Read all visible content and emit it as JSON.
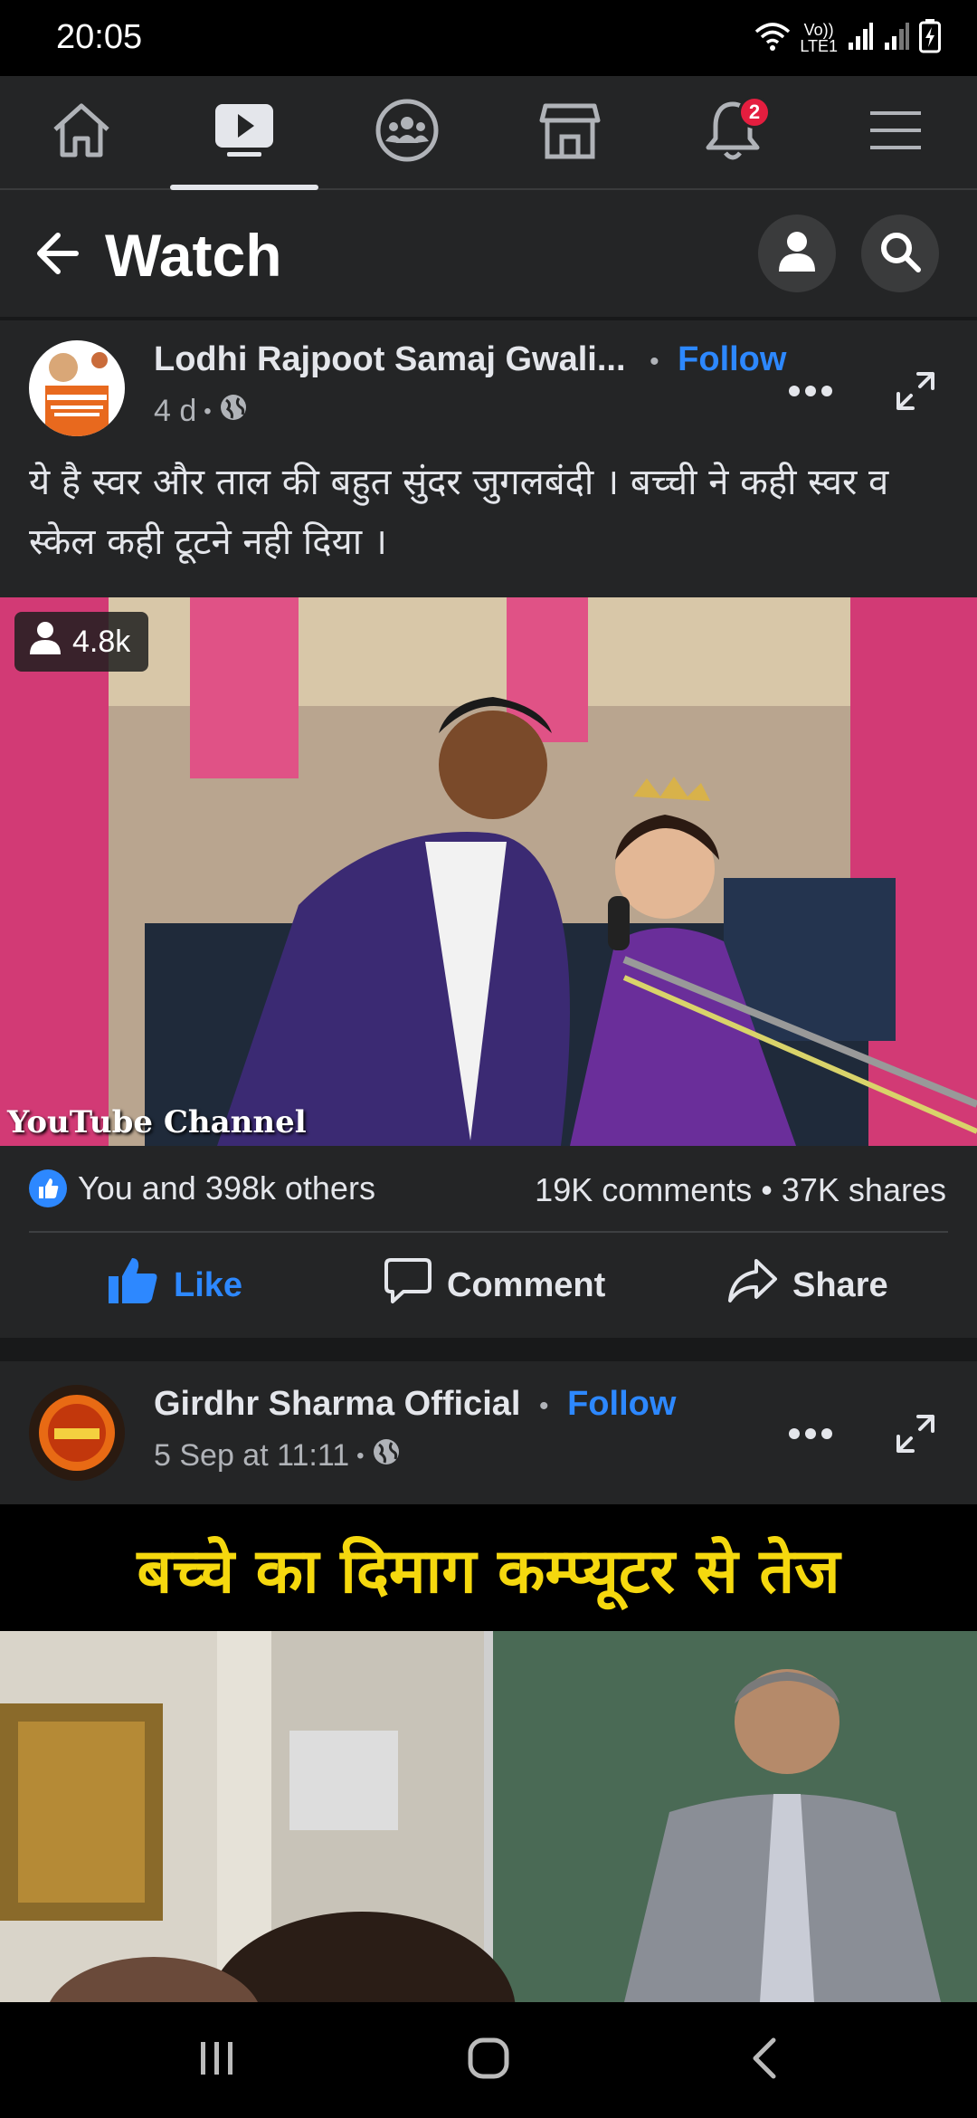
{
  "status_bar": {
    "time": "20:05",
    "network_top": "Vo))",
    "network_bottom": "LTE1",
    "icons": [
      "wifi-icon",
      "signal-icon",
      "signal-icon",
      "battery-charging-icon"
    ]
  },
  "top_nav": {
    "tabs": [
      {
        "name": "home",
        "icon": "home-icon",
        "active": false
      },
      {
        "name": "watch",
        "icon": "video-play-icon",
        "active": true
      },
      {
        "name": "groups",
        "icon": "groups-icon",
        "active": false
      },
      {
        "name": "marketplace",
        "icon": "shop-icon",
        "active": false
      },
      {
        "name": "notifications",
        "icon": "bell-icon",
        "active": false,
        "badge": "2"
      },
      {
        "name": "menu",
        "icon": "hamburger-menu-icon",
        "active": false
      }
    ]
  },
  "watch_header": {
    "title": "Watch",
    "icons": [
      "back-arrow-icon",
      "profile-icon",
      "search-icon"
    ]
  },
  "posts": [
    {
      "page_name": "Lodhi Rajpoot Samaj Gwali...",
      "separator": "•",
      "follow_label": "Follow",
      "time": "4 d",
      "meta_separator": "•",
      "privacy_icon": "globe-icon",
      "caption": "ये है स्वर और ताल की बहुत सुंदर जुगलबंदी । बच्ची ने कही स्वर व स्केल कही टूटने नही दिया ।",
      "viewer_count": "4.8k",
      "video_watermark": "YouTube Channel",
      "reactions_text": "You and 398k others",
      "counts_text": "19K comments • 37K shares",
      "actions": {
        "like": "Like",
        "comment": "Comment",
        "share": "Share"
      }
    },
    {
      "page_name": "Girdhr Sharma Official",
      "separator": "•",
      "follow_label": "Follow",
      "time": "5 Sep at 11:11",
      "meta_separator": "•",
      "privacy_icon": "globe-icon",
      "video_banner": "बच्चे का दिमाग कम्प्यूटर से तेज"
    }
  ],
  "colors": {
    "background": "#242526",
    "separator": "#18191a",
    "accent": "#2d88ff",
    "badge": "#e41e3f",
    "banner_text": "#f5d80e"
  },
  "system_nav": {
    "icons": [
      "recent-apps-icon",
      "home-circle-icon",
      "system-back-icon"
    ]
  }
}
